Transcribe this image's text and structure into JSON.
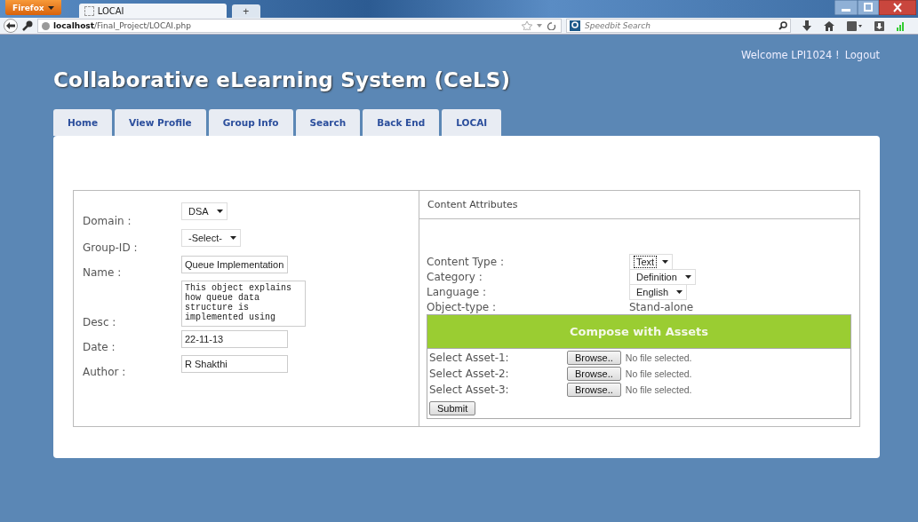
{
  "browser": {
    "menu_button": "Firefox",
    "tab_title": "LOCAI",
    "new_tab": "+",
    "url": "**localhost**/Final_Project/LOCAI.php",
    "search_placeholder": "Speedbit Search"
  },
  "header": {
    "title": "Collaborative eLearning System (CeLS)",
    "welcome": "Welcome LPI1024 !",
    "logout": "Logout"
  },
  "nav_tabs": [
    {
      "label": "Home"
    },
    {
      "label": "View Profile"
    },
    {
      "label": "Group Info"
    },
    {
      "label": "Search"
    },
    {
      "label": "Back End"
    },
    {
      "label": "LOCAI"
    }
  ],
  "form": {
    "fields": [
      {
        "label": "Domain :",
        "kind": "select",
        "value": "DSA"
      },
      {
        "label": "Group-ID :",
        "kind": "select",
        "value": "-Select-"
      },
      {
        "label": "Name :",
        "kind": "input",
        "value": "Queue Implementation"
      },
      {
        "label": "Desc :",
        "kind": "textarea",
        "value": "This object explains how queue data structure is implemented using"
      },
      {
        "label": "Date :",
        "kind": "input",
        "value": "22-11-13"
      },
      {
        "label": "Author :",
        "kind": "input",
        "value": "R Shakthi"
      }
    ]
  },
  "content_attributes": {
    "title": "Content Attributes",
    "fields": [
      {
        "label": "Content Type :",
        "kind": "select",
        "value": "Text",
        "focused": true
      },
      {
        "label": "Category :",
        "kind": "select",
        "value": "Definition",
        "focused": false
      },
      {
        "label": "Language :",
        "kind": "select",
        "value": "English",
        "focused": false
      },
      {
        "label": "Object-type :",
        "kind": "text",
        "value": "Stand-alone"
      }
    ],
    "compose": {
      "title": "Compose with Assets",
      "assets": [
        {
          "label": "Select Asset-1:",
          "button": "Browse..",
          "status": "No file selected."
        },
        {
          "label": "Select Asset-2:",
          "button": "Browse..",
          "status": "No file selected."
        },
        {
          "label": "Select Asset-3:",
          "button": "Browse..",
          "status": "No file selected."
        }
      ],
      "submit": "Submit"
    }
  }
}
